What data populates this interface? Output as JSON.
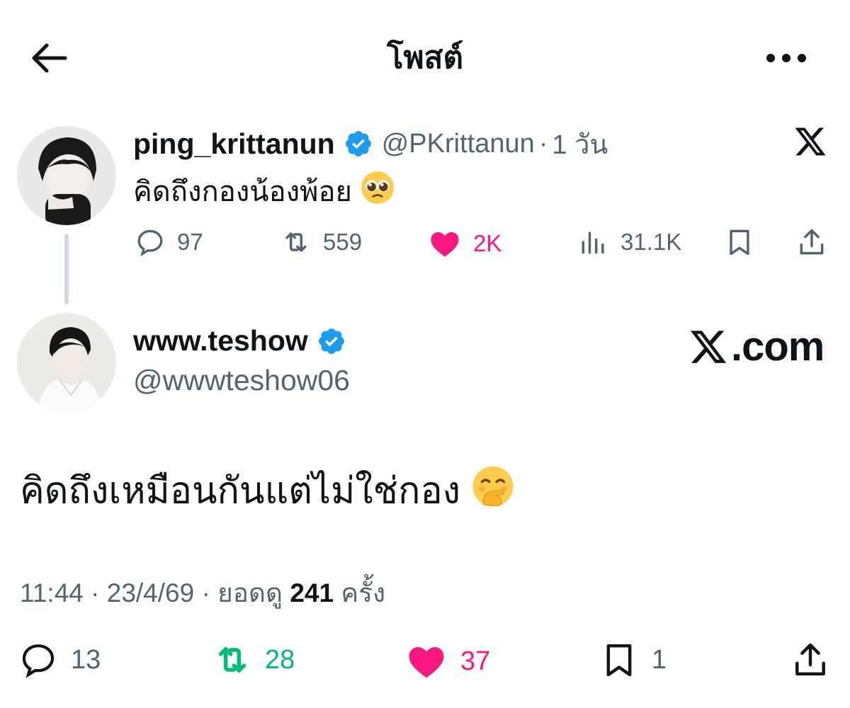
{
  "header": {
    "title": "โพสต์",
    "icons": {
      "back": "arrow-left-icon",
      "more": "more-horizontal-icon"
    }
  },
  "quoted_post": {
    "display_name": "ping_krittanun",
    "handle": "@PKrittanun",
    "separator": "·",
    "time": "1 วัน",
    "text": "คิดถึงกองน้องพ้อย",
    "emoji": "pleading-face-emoji",
    "actions": {
      "replies": "97",
      "reposts": "559",
      "likes": "2K",
      "views": "31.1K"
    }
  },
  "main_post": {
    "display_name": "www.teshow",
    "handle": "@wwwteshow06",
    "watermark": ".com",
    "text": "คิดถึงเหมือนกันแต่ไม่ใช่กอง",
    "emoji": "face-with-hand-over-mouth-emoji",
    "meta": {
      "time": "11:44",
      "sep1": "·",
      "date": "23/4/69",
      "sep2": "·",
      "views_label": "ยอดดู",
      "views_count": "241",
      "views_unit": "ครั้ง"
    },
    "actions": {
      "replies": "13",
      "reposts": "28",
      "likes": "37",
      "bookmarks": "1"
    }
  },
  "colors": {
    "text": "#0f1419",
    "muted": "#536471",
    "verified": "#1d9bf0",
    "like": "#f91880",
    "repost": "#00ba7c",
    "thread_line": "#cfd9de"
  }
}
